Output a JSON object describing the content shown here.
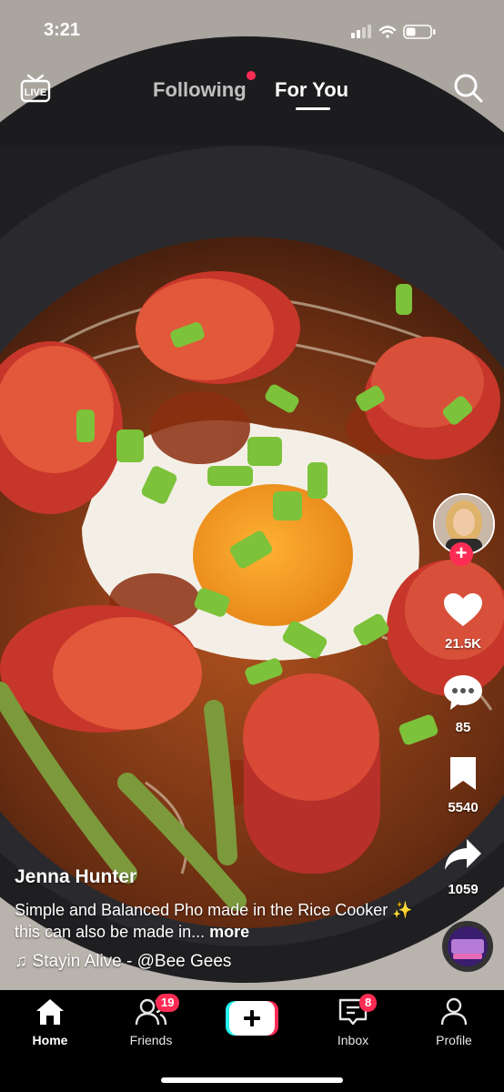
{
  "status": {
    "time": "3:21"
  },
  "topnav": {
    "following": "Following",
    "for_you": "For You"
  },
  "video": {
    "author": "Jenna Hunter",
    "description": "Simple and Balanced Pho made in the Rice Cooker ✨  this can also be made in... ",
    "more": "more",
    "music": "♫ Stayin Alive - @Bee Gees"
  },
  "actions": {
    "likes": "21.5K",
    "comments": "85",
    "saves": "5540",
    "shares": "1059"
  },
  "bottom_nav": {
    "home": "Home",
    "friends": "Friends",
    "friends_badge": "19",
    "inbox": "Inbox",
    "inbox_badge": "8",
    "profile": "Profile"
  },
  "colors": {
    "accent": "#fe2c55",
    "cyan": "#25f4ee"
  }
}
